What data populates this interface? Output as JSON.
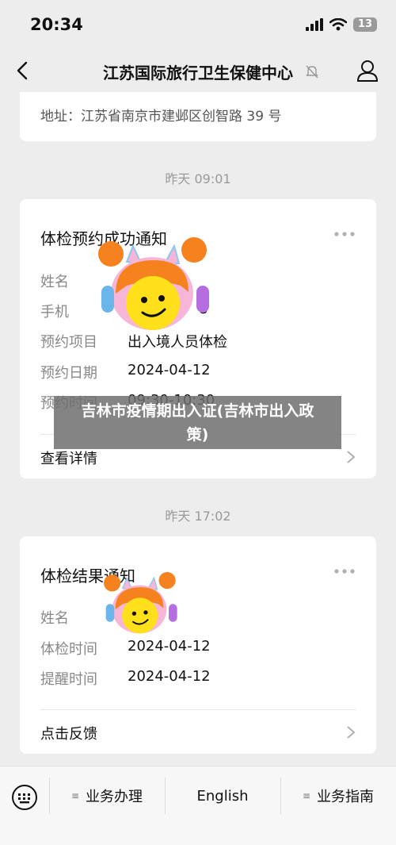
{
  "status_bar": {
    "time": "20:34",
    "battery": "13"
  },
  "nav": {
    "title": "江苏国际旅行卫生保健中心"
  },
  "address": {
    "text": "地址：江苏省南京市建邺区创智路 39 号"
  },
  "messages": [
    {
      "timestamp": "昨天 09:01",
      "title": "体检预约成功通知",
      "rows": [
        {
          "label": "姓名",
          "value": ""
        },
        {
          "label": "手机",
          "value": "8"
        },
        {
          "label": "预约项目",
          "value": "出入境人员体检"
        },
        {
          "label": "预约日期",
          "value": "2024-04-12"
        },
        {
          "label": "预约时间",
          "value": "09:30-10:30"
        }
      ],
      "footer": "查看详情"
    },
    {
      "timestamp": "昨天 17:02",
      "title": "体检结果通知",
      "rows": [
        {
          "label": "姓名",
          "value": ""
        },
        {
          "label": "体检时间",
          "value": "2024-04-12"
        },
        {
          "label": "提醒时间",
          "value": "2024-04-12"
        }
      ],
      "footer": "点击反馈"
    }
  ],
  "overlay": {
    "line1": "吉林市疫情期出入证(吉林市出入政",
    "line2": "策)"
  },
  "bottom_menu": [
    {
      "label": "业务办理"
    },
    {
      "label": "English"
    },
    {
      "label": "业务指南"
    }
  ],
  "colors": {
    "background": "#ededed",
    "card": "#ffffff",
    "sticker_orange": "#f5821f",
    "sticker_pink": "#f7b6d8",
    "sticker_face": "#ffe01a"
  }
}
